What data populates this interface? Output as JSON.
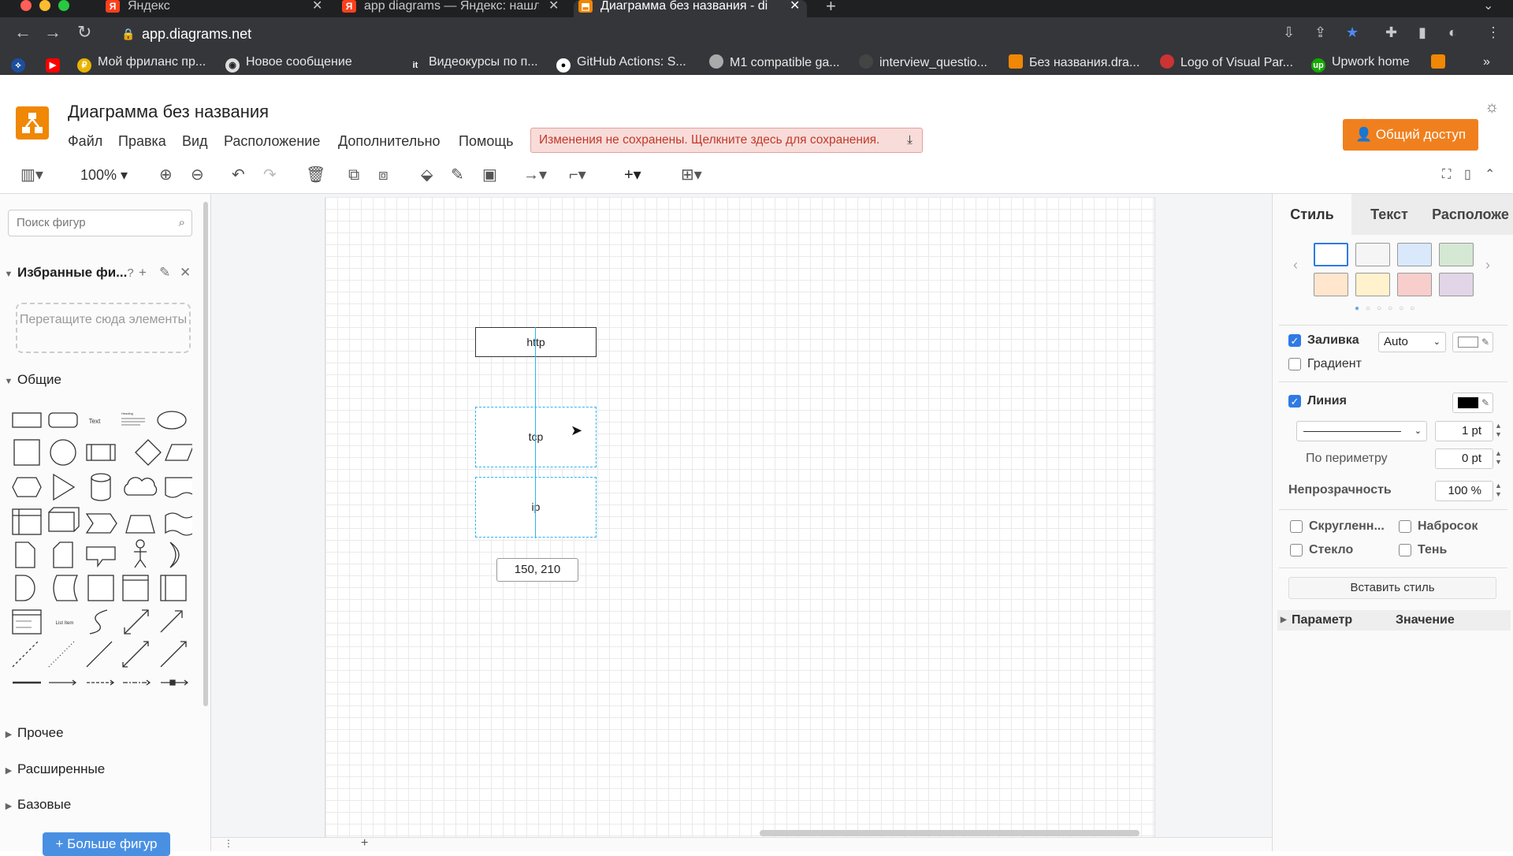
{
  "browser": {
    "tabs": [
      {
        "title": "Яндекс",
        "icon": "yandex-icon"
      },
      {
        "title": "app diagrams — Яндекс: нашл",
        "icon": "yandex-icon"
      },
      {
        "title": "Диаграмма без названия - di",
        "icon": "drawio-icon"
      }
    ],
    "url": "app.diagrams.net",
    "bookmarks": [
      "Мой фриланс пр...",
      "Новое сообщение",
      "Видеокурсы по п...",
      "GitHub Actions: S...",
      "M1 compatible ga...",
      "interview_questio...",
      "Без названия.dra...",
      "Logo of Visual Par...",
      "Upwork home"
    ]
  },
  "app": {
    "title": "Диаграмма без названия",
    "menus": [
      "Файл",
      "Правка",
      "Вид",
      "Расположение",
      "Дополнительно",
      "Помощь"
    ],
    "unsaved_notice": "Изменения не сохранены. Щелкните здесь для сохранения.",
    "share_label": "Общий доступ",
    "zoom": "100%"
  },
  "left_panel": {
    "search_placeholder": "Поиск фигур",
    "favorites_title": "Избранные фи...",
    "help_mark": "?",
    "dropzone_text": "Перетащите сюда элементы",
    "sections": [
      "Общие",
      "Прочее",
      "Расширенные",
      "Базовые"
    ],
    "shape_text_label": "Text",
    "shape_heading_label": "Heading",
    "list_item_label": "List Item",
    "more_shapes": "+ Больше фигур"
  },
  "canvas": {
    "nodes": [
      "http",
      "tcp",
      "ip"
    ],
    "coords": "150, 210"
  },
  "right_panel": {
    "tabs": [
      "Стиль",
      "Текст",
      "Расположе"
    ],
    "swatch_colors": [
      "#ffffff",
      "#f5f5f5",
      "#dae8fc",
      "#d5e8d4",
      "#ffe6cc",
      "#fff2cc",
      "#f8cecc",
      "#e1d5e7"
    ],
    "fill_label": "Заливка",
    "fill_mode": "Auto",
    "gradient_label": "Градиент",
    "line_label": "Линия",
    "line_width": "1 pt",
    "perimeter_label": "По периметру",
    "perimeter_value": "0 pt",
    "opacity_label": "Непрозрачность",
    "opacity_value": "100 %",
    "rounded_label": "Скругленн...",
    "sketch_label": "Набросок",
    "glass_label": "Стекло",
    "shadow_label": "Тень",
    "paste_style": "Вставить стиль",
    "param_header": "Параметр",
    "value_header": "Значение"
  }
}
